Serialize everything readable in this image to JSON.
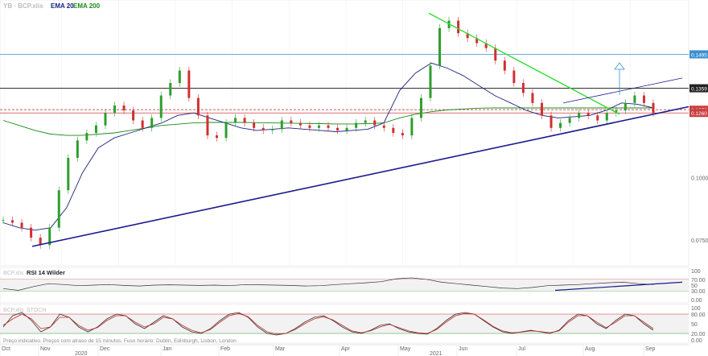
{
  "header": {
    "symbol": "YB · BCP.xlis",
    "legend": [
      {
        "label": "EMA 20",
        "color": "#1a237e"
      },
      {
        "label": "EMA 200",
        "color": "#1b8a1b"
      }
    ]
  },
  "footer_note": "Preço indicativo. Preços com atraso de 15 minutos. Fuso horário: Dublin, Edinburgh, Lisbon, London",
  "rsi_panel": {
    "ticker": "BCP.xlis",
    "title": "RSI 14 Wilder"
  },
  "stoch_panel": {
    "ticker": "BCP.xlis",
    "title": "STOCH"
  },
  "chart_data": [
    {
      "type": "candlestick",
      "title": "",
      "xlabel": "",
      "ylabel": "",
      "x_ticks": [
        "Oct",
        "Nov",
        "Dec",
        "Jan",
        "Feb",
        "Mar",
        "Apr",
        "May",
        "Jun",
        "Jul",
        "Aug",
        "Sep"
      ],
      "year_labels": [
        "2020",
        "2021"
      ],
      "y_ticks": [
        "0.1495",
        "0.1359",
        "0.1273",
        "0.1260",
        "0.1000",
        "0.0750"
      ],
      "ylim": [
        0.066,
        0.17
      ],
      "series": [
        {
          "name": "EMA 20",
          "color": "#1a237e",
          "values": [
            0.082,
            0.08,
            0.079,
            0.08,
            0.088,
            0.102,
            0.112,
            0.116,
            0.118,
            0.12,
            0.122,
            0.125,
            0.126,
            0.124,
            0.122,
            0.12,
            0.119,
            0.1195,
            0.12,
            0.1195,
            0.119,
            0.1185,
            0.119,
            0.1195,
            0.122,
            0.135,
            0.142,
            0.146,
            0.144,
            0.141,
            0.137,
            0.133,
            0.13,
            0.127,
            0.125,
            0.124,
            0.1245,
            0.125,
            0.127,
            0.13,
            0.1295,
            0.128
          ]
        },
        {
          "name": "EMA 200",
          "color": "#1b8a1b",
          "values": [
            0.123,
            0.121,
            0.119,
            0.1175,
            0.117,
            0.117,
            0.1175,
            0.118,
            0.119,
            0.12,
            0.121,
            0.1215,
            0.122,
            0.1222,
            0.1222,
            0.1222,
            0.1221,
            0.122,
            0.1219,
            0.1218,
            0.1217,
            0.1216,
            0.1216,
            0.1217,
            0.122,
            0.124,
            0.1255,
            0.1265,
            0.1272,
            0.1276,
            0.1279,
            0.128,
            0.128,
            0.128,
            0.128,
            0.128,
            0.128,
            0.128,
            0.128,
            0.128,
            0.128,
            0.128
          ]
        }
      ],
      "closes": [
        0.083,
        0.082,
        0.08,
        0.076,
        0.073,
        0.08,
        0.095,
        0.108,
        0.115,
        0.118,
        0.121,
        0.126,
        0.129,
        0.127,
        0.123,
        0.12,
        0.124,
        0.133,
        0.138,
        0.143,
        0.132,
        0.125,
        0.117,
        0.116,
        0.122,
        0.124,
        0.122,
        0.12,
        0.119,
        0.1195,
        0.123,
        0.122,
        0.121,
        0.12,
        0.121,
        0.12,
        0.119,
        0.12,
        0.122,
        0.123,
        0.121,
        0.12,
        0.118,
        0.117,
        0.124,
        0.132,
        0.145,
        0.16,
        0.163,
        0.158,
        0.156,
        0.154,
        0.152,
        0.147,
        0.143,
        0.138,
        0.134,
        0.13,
        0.125,
        0.12,
        0.122,
        0.124,
        0.126,
        0.125,
        0.123,
        0.126,
        0.127,
        0.13,
        0.133,
        0.13,
        0.126
      ],
      "trendlines": [
        {
          "name": "support",
          "color": "#1a1a8c",
          "from": [
            0.0,
            0.0725
          ],
          "to": [
            1.0,
            0.1285
          ]
        },
        {
          "name": "resistance",
          "color": "#33dd33",
          "from": [
            0.0,
            0.166
          ],
          "to": [
            1.0,
            0.1255
          ]
        }
      ],
      "horizontal_lines": [
        {
          "value": 0.1495,
          "color": "#3a8fd0"
        },
        {
          "value": 0.1359,
          "color": "#222222"
        },
        {
          "value": 0.1273,
          "color": "#c94040"
        },
        {
          "value": 0.126,
          "color": "#c94040"
        }
      ],
      "annotation": "up-arrow target marker above 0.1359",
      "grid": true
    },
    {
      "type": "line",
      "title": "RSI 14 Wilder",
      "y_ticks": [
        "100",
        "70.00",
        "50",
        "30.00",
        "0.00"
      ],
      "ylim": [
        0,
        100
      ],
      "series": [
        {
          "name": "RSI",
          "color": "#333333",
          "values": [
            38,
            32,
            45,
            55,
            52,
            48,
            50,
            52,
            49,
            47,
            50,
            51,
            50,
            49,
            50,
            48,
            52,
            51,
            50,
            49,
            47,
            48,
            52,
            55,
            58,
            62,
            72,
            75,
            70,
            60,
            55,
            50,
            45,
            40,
            38,
            42,
            48,
            50,
            52,
            55,
            58,
            60,
            55,
            52
          ]
        }
      ],
      "levels": [
        70,
        30
      ],
      "trendline": {
        "color": "#1a1a8c",
        "from": [
          0.62,
          32
        ],
        "to": [
          1.0,
          60
        ]
      }
    },
    {
      "type": "line",
      "title": "STOCH",
      "y_ticks": [
        "100",
        "80.00",
        "50",
        "20.00",
        "0.00"
      ],
      "ylim": [
        0,
        100
      ],
      "series": [
        {
          "name": "%K",
          "color": "#333333",
          "values": [
            40,
            75,
            85,
            60,
            25,
            40,
            80,
            70,
            40,
            25,
            40,
            65,
            80,
            75,
            50,
            35,
            55,
            75,
            65,
            40,
            25,
            20,
            35,
            60,
            80,
            85,
            70,
            40,
            20,
            15,
            20,
            35,
            55,
            70,
            75,
            60,
            40,
            25,
            20,
            30,
            45,
            50,
            35,
            25,
            20,
            18,
            35,
            60,
            80,
            85,
            80,
            60,
            40,
            25,
            20,
            25,
            30,
            25,
            20,
            30,
            60,
            80,
            75,
            50,
            35,
            60,
            80,
            75,
            50,
            30
          ]
        },
        {
          "name": "%D",
          "color": "#c62828",
          "values": [
            45,
            65,
            80,
            65,
            35,
            40,
            70,
            70,
            45,
            30,
            38,
            60,
            75,
            75,
            55,
            40,
            50,
            70,
            65,
            45,
            30,
            22,
            32,
            55,
            75,
            82,
            72,
            45,
            25,
            18,
            20,
            32,
            50,
            65,
            72,
            62,
            45,
            28,
            22,
            28,
            40,
            48,
            38,
            28,
            22,
            20,
            32,
            55,
            75,
            82,
            80,
            62,
            42,
            28,
            22,
            24,
            28,
            26,
            22,
            28,
            55,
            75,
            75,
            55,
            38,
            55,
            75,
            75,
            55,
            35
          ]
        }
      ],
      "levels": [
        80,
        20
      ]
    }
  ]
}
